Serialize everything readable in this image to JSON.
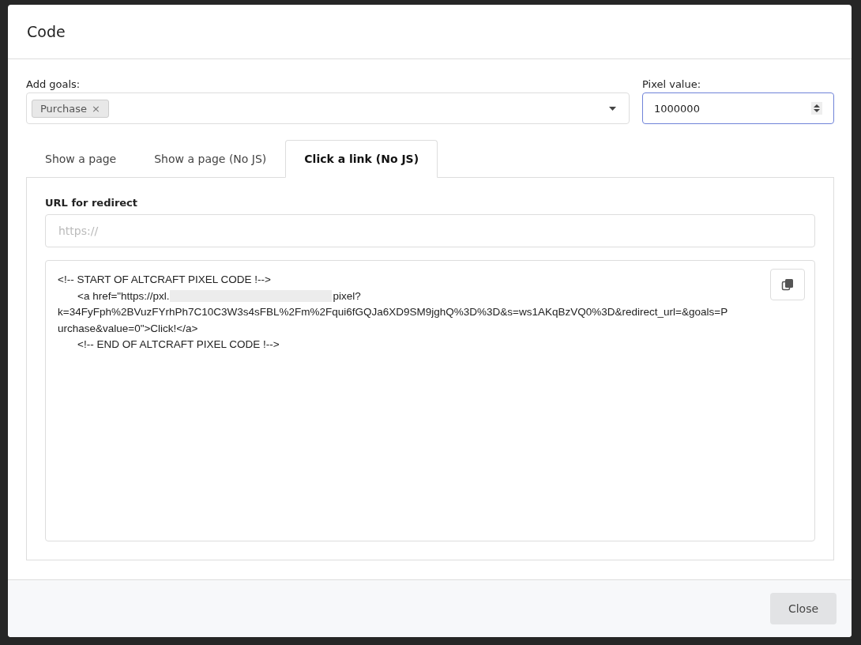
{
  "modal": {
    "title": "Code"
  },
  "goals": {
    "label": "Add goals:",
    "tags": [
      {
        "label": "Purchase",
        "remove": "×"
      }
    ]
  },
  "pixel_value": {
    "label": "Pixel value:",
    "value": "1000000"
  },
  "tabs": [
    {
      "label": "Show a page",
      "selected": false
    },
    {
      "label": "Show a page (No JS)",
      "selected": false
    },
    {
      "label": "Click a link (No JS)",
      "selected": true
    }
  ],
  "redirect": {
    "label": "URL for redirect",
    "placeholder": "https://"
  },
  "code_lines": [
    {
      "text": "<!-- START OF ALTCRAFT PIXEL CODE !-->",
      "indent": false
    },
    {
      "text": "<a href=\"https://pxl.",
      "redacted": true,
      "after": "pixel?",
      "indent": true
    },
    {
      "text": "k=34FyFph%2BVuzFYrhPh7C10C3W3s4sFBL%2Fm%2Fqui6fGQJa6XD9SM9jghQ%3D%3D&s=ws1AKqBzVQ0%3D&redirect_url=&goals=P",
      "indent": false
    },
    {
      "text": "urchase&value=0\">Click!</a>",
      "indent": false
    },
    {
      "text": "<!-- END OF ALTCRAFT PIXEL CODE !-->",
      "indent": true
    }
  ],
  "footer": {
    "close": "Close"
  }
}
